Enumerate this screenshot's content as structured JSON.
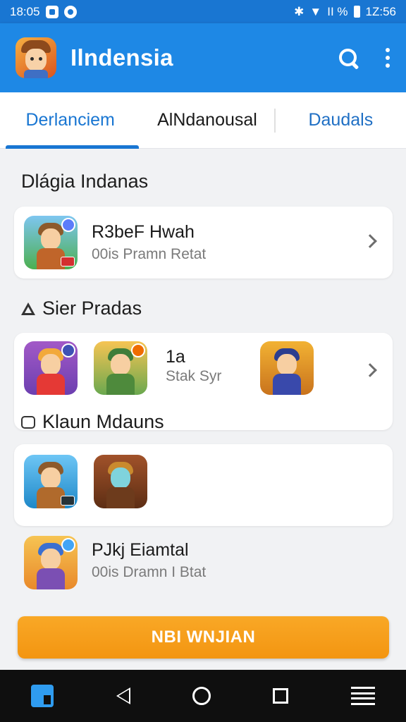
{
  "status_bar": {
    "time": "18:05",
    "battery_text": "1Z:56",
    "signal_text": "ΙΙ %"
  },
  "app_bar": {
    "title": "Ilndensia",
    "logo_icon": "app-logo-character",
    "actions": [
      "search-icon",
      "more-vert-icon"
    ]
  },
  "tabs": [
    {
      "label": "Derlanciem",
      "selected": true
    },
    {
      "label": "AlNdanousal",
      "selected": false
    },
    {
      "label": "Daudals",
      "selected": false
    }
  ],
  "sections": {
    "first": {
      "title": "Dlágia Indanas"
    },
    "second": {
      "title": "Sier Pradas"
    },
    "third": {
      "title": "Klaun Mdauns"
    }
  },
  "featured_item": {
    "title": "R3beF Hwah",
    "subtitle": "00is Pramn Retat"
  },
  "row_item": {
    "title": "1a",
    "subtitle": "Stak Syr"
  },
  "second_item": {
    "title": "PJkj Eiamtal",
    "subtitle": "00is Dramn I Btat"
  },
  "cta": {
    "label": "NBI WNJIAN"
  },
  "colors": {
    "primary": "#1e88e5",
    "accent": "#f39511",
    "tab_active": "#1976d2"
  }
}
